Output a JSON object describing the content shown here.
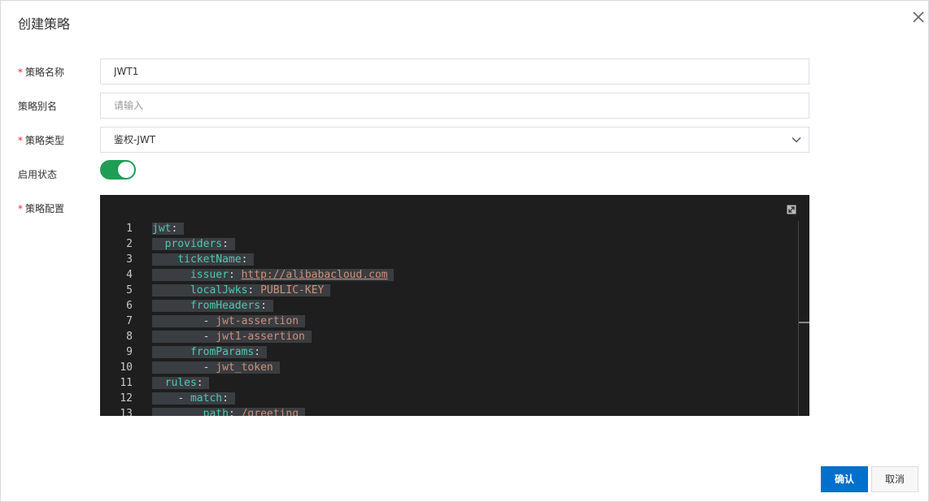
{
  "dialog": {
    "title": "创建策略",
    "close_icon": "close-icon"
  },
  "form": {
    "name": {
      "label": "策略名称",
      "required": "*",
      "value": "JWT1"
    },
    "alias": {
      "label": "策略别名",
      "placeholder": "请输入",
      "value": ""
    },
    "type": {
      "label": "策略类型",
      "required": "*",
      "value": "鉴权-JWT",
      "icon": "chevron-down-icon"
    },
    "enabled": {
      "label": "启用状态",
      "on": true
    },
    "config": {
      "label": "策略配置",
      "required": "*",
      "expand_icon": "expand-icon"
    }
  },
  "editor": {
    "lines": [
      {
        "num": "1",
        "indent": "",
        "key": "jwt",
        "colon": ":",
        "value": "",
        "value_type": ""
      },
      {
        "num": "2",
        "indent": "  ",
        "key": "providers",
        "colon": ":",
        "value": "",
        "value_type": ""
      },
      {
        "num": "3",
        "indent": "    ",
        "key": "ticketName",
        "colon": ":",
        "value": "",
        "value_type": ""
      },
      {
        "num": "4",
        "indent": "      ",
        "key": "issuer",
        "colon": ": ",
        "value": "http://alibabacloud.com",
        "value_type": "url"
      },
      {
        "num": "5",
        "indent": "      ",
        "key": "localJwks",
        "colon": ": ",
        "value": "PUBLIC-KEY",
        "value_type": "string"
      },
      {
        "num": "6",
        "indent": "      ",
        "key": "fromHeaders",
        "colon": ":",
        "value": "",
        "value_type": ""
      },
      {
        "num": "7",
        "indent": "        ",
        "key": "- ",
        "colon": "",
        "value": "jwt-assertion",
        "value_type": "listitem"
      },
      {
        "num": "8",
        "indent": "        ",
        "key": "- ",
        "colon": "",
        "value": "jwt1-assertion",
        "value_type": "listitem"
      },
      {
        "num": "9",
        "indent": "      ",
        "key": "fromParams",
        "colon": ":",
        "value": "",
        "value_type": ""
      },
      {
        "num": "10",
        "indent": "        ",
        "key": "- ",
        "colon": "",
        "value": "jwt_token",
        "value_type": "listitem"
      },
      {
        "num": "11",
        "indent": "  ",
        "key": "rules",
        "colon": ":",
        "value": "",
        "value_type": ""
      },
      {
        "num": "12",
        "indent": "    ",
        "key": "- match",
        "colon": ":",
        "value": "",
        "value_type": "dashkey"
      },
      {
        "num": "13",
        "indent": "        ",
        "key": "path",
        "colon": ": ",
        "value": "/greeting",
        "value_type": "string"
      }
    ]
  },
  "footer": {
    "confirm_label": "确认",
    "cancel_label": "取消"
  },
  "colors": {
    "primary": "#0070cc",
    "toggle_on": "#1f9d55",
    "editor_bg": "#1e1e1e",
    "required": "#f5222d"
  }
}
